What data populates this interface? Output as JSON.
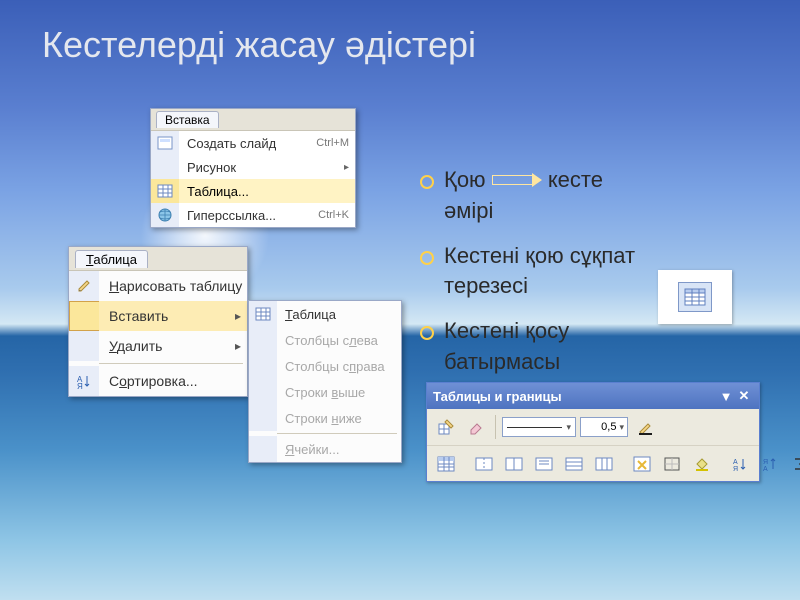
{
  "title": "Кестелерді жасау әдістері",
  "menu1": {
    "header": "Вставка",
    "items": [
      {
        "label": "Создать слайд",
        "shortcut": "Ctrl+M",
        "icon": "new-slide"
      },
      {
        "label": "Рисунок",
        "shortcut": "",
        "icon": "none",
        "submenu": true
      },
      {
        "label": "Таблица...",
        "shortcut": "",
        "icon": "table",
        "highlight": true
      },
      {
        "label": "Гиперссылка...",
        "shortcut": "Ctrl+K",
        "icon": "hyperlink"
      }
    ]
  },
  "menu2": {
    "header": "Таблица",
    "items": [
      {
        "label": "Нарисовать таблицу",
        "icon": "pencil"
      },
      {
        "label": "Вставить",
        "icon": "none",
        "submenu": true,
        "highlight": true
      },
      {
        "label": "Удалить",
        "icon": "none",
        "submenu": true
      },
      {
        "sep": true
      },
      {
        "label": "Сортировка...",
        "icon": "sort"
      }
    ]
  },
  "submenu": {
    "items": [
      {
        "label": "Таблица",
        "icon": "table",
        "enabled": true
      },
      {
        "label": "Столбцы слева",
        "enabled": false
      },
      {
        "label": "Столбцы справа",
        "enabled": false
      },
      {
        "label": "Строки выше",
        "enabled": false
      },
      {
        "label": "Строки ниже",
        "enabled": false
      },
      {
        "sep": true
      },
      {
        "label": "Ячейки...",
        "enabled": false
      }
    ]
  },
  "bullets": [
    {
      "text_before": "Қою",
      "arrow": true,
      "text_after": "кесте әмірі"
    },
    {
      "text": "Кестені қою сұқпат терезесі"
    },
    {
      "text": "Кестені қосу батырмасы"
    }
  ],
  "toolbar": {
    "title": "Таблицы и границы",
    "width_value": "0,5",
    "buttons_row2": [
      "insert-table",
      "merge-cells",
      "split-cells",
      "align-top",
      "align-center",
      "distribute-rows",
      "distribute-cols",
      "autoformat",
      "border-style",
      "fill",
      "sort-asc",
      "sort-desc",
      "autosum"
    ]
  }
}
